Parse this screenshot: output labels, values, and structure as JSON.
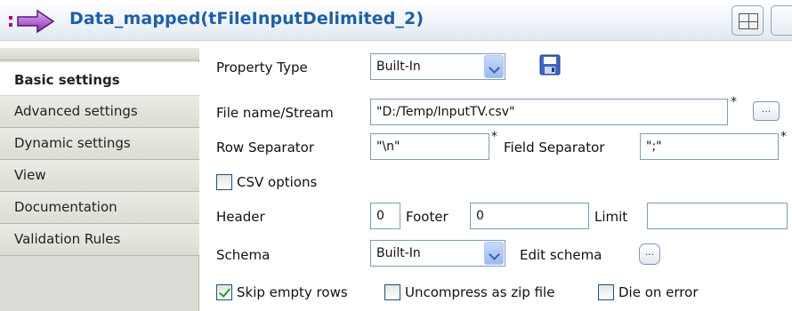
{
  "header": {
    "title": "Data_mapped(tFileInputDelimited_2)"
  },
  "sidebar": {
    "items": [
      {
        "label": "Basic settings",
        "active": true
      },
      {
        "label": "Advanced settings"
      },
      {
        "label": "Dynamic settings"
      },
      {
        "label": "View"
      },
      {
        "label": "Documentation"
      },
      {
        "label": "Validation Rules"
      }
    ]
  },
  "form": {
    "property_type_label": "Property Type",
    "property_type_value": "Built-In",
    "file_label": "File name/Stream",
    "file_value": "\"D:/Temp/InputTV.csv\"",
    "required_mark": "*",
    "dots": "...",
    "row_sep_label": "Row Separator",
    "row_sep_value": "\"\\n\"",
    "field_sep_label": "Field Separator",
    "field_sep_value": "\";\"",
    "csv_label": "CSV options",
    "header_label": "Header",
    "header_value": "0",
    "footer_label": "Footer",
    "footer_value": "0",
    "limit_label": "Limit",
    "limit_value": "",
    "schema_label": "Schema",
    "schema_value": "Built-In",
    "edit_schema_label": "Edit schema",
    "skip_label": "Skip empty rows",
    "uncompress_label": "Uncompress as zip file",
    "die_label": "Die on error"
  },
  "checks": {
    "csv_options": false,
    "skip_empty_rows": true,
    "uncompress_zip": false,
    "die_on_error": false
  },
  "colors": {
    "title": "#1f5fa8",
    "accent_purple": "#b0008a",
    "check_green": "#21a121"
  }
}
